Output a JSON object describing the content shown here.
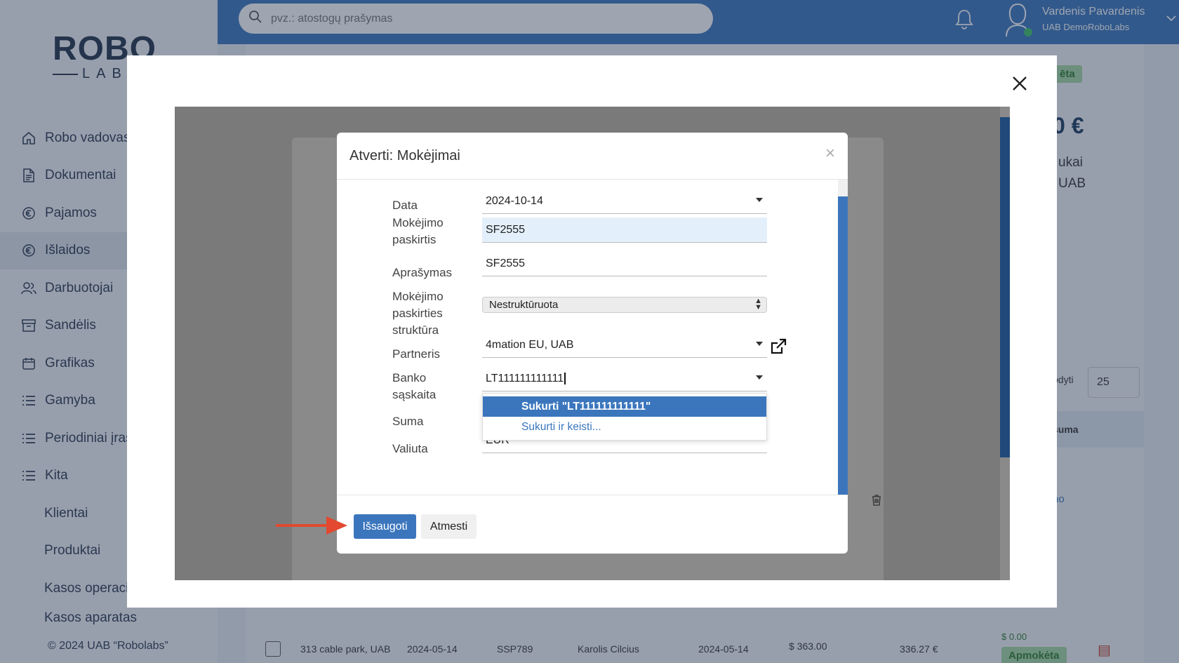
{
  "app": {
    "logo": {
      "word": "ROBO",
      "sub": "LABS"
    },
    "search": {
      "placeholder": "pvz.: atostogų prašymas"
    },
    "user": {
      "name": "Vardenis Pavardenis",
      "company": "UAB DemoRoboLabs"
    },
    "copyright": "© 2024 UAB “Robolabs”"
  },
  "sidebar": {
    "items": [
      {
        "label": "Robo vadovas",
        "icon": "home-icon"
      },
      {
        "label": "Dokumentai",
        "icon": "document-icon"
      },
      {
        "label": "Pajamos",
        "icon": "income-icon"
      },
      {
        "label": "Išlaidos",
        "icon": "expense-icon",
        "active": true
      },
      {
        "label": "Darbuotojai",
        "icon": "people-icon"
      },
      {
        "label": "Sandėlis",
        "icon": "archive-icon"
      },
      {
        "label": "Grafikas",
        "icon": "calendar-icon"
      },
      {
        "label": "Gamyba",
        "icon": "list-icon"
      },
      {
        "label": "Periodiniai įraš",
        "icon": "list-icon"
      },
      {
        "label": "Kita",
        "icon": "list-icon"
      },
      {
        "label": "Klientai",
        "sub": true
      },
      {
        "label": "Produktai",
        "sub": true
      },
      {
        "label": "Kasos operacij",
        "sub": true
      },
      {
        "label": "Kasos aparatas",
        "sub": true
      }
    ]
  },
  "background": {
    "stat_value": "0 €",
    "stat_line1": "ukai",
    "stat_line2": "UAB",
    "badge_top": "ēta",
    "rodyti_label": "odyti",
    "page_size": "25",
    "col_suma": "suma",
    "link_no": "no",
    "row": {
      "partner": "313 cable park, UAB",
      "date": "2024-05-14",
      "number": "SSP789",
      "person": "Karolis Cilcius",
      "date2": "2024-05-14",
      "amount_usd": "$ 363.00",
      "amount_eur": "336.27 €",
      "paid_amount": "$ 0.00",
      "status": "Apmokėta"
    },
    "frame_text": "ta"
  },
  "dialog": {
    "title": "Atverti: Mokėjimai",
    "close": "×",
    "fields": {
      "data": {
        "label": "Data",
        "value": "2024-10-14"
      },
      "paskirtis": {
        "label_1": "Mokėjimo",
        "label_2": "paskirtis",
        "value": "SF2555"
      },
      "aprasymas": {
        "label": "Aprašymas",
        "value": "SF2555"
      },
      "struktura": {
        "label_1": "Mokėjimo",
        "label_2": "paskirties",
        "label_3": "struktūra",
        "value": "Nestruktūruota"
      },
      "partneris": {
        "label": "Partneris",
        "value": "4mation EU, UAB"
      },
      "banko": {
        "label_1": "Banko",
        "label_2": "sąskaita",
        "value": "LT111111111111"
      },
      "suma": {
        "label": "Suma"
      },
      "valiuta": {
        "label": "Valiuta",
        "value": "EUR"
      }
    },
    "dropdown": [
      {
        "label": "Sukurti \"LT111111111111\"",
        "active": true
      },
      {
        "label": "Sukurti ir keisti...",
        "active": false
      }
    ],
    "buttons": {
      "save": "Išsaugoti",
      "cancel": "Atmesti"
    }
  }
}
